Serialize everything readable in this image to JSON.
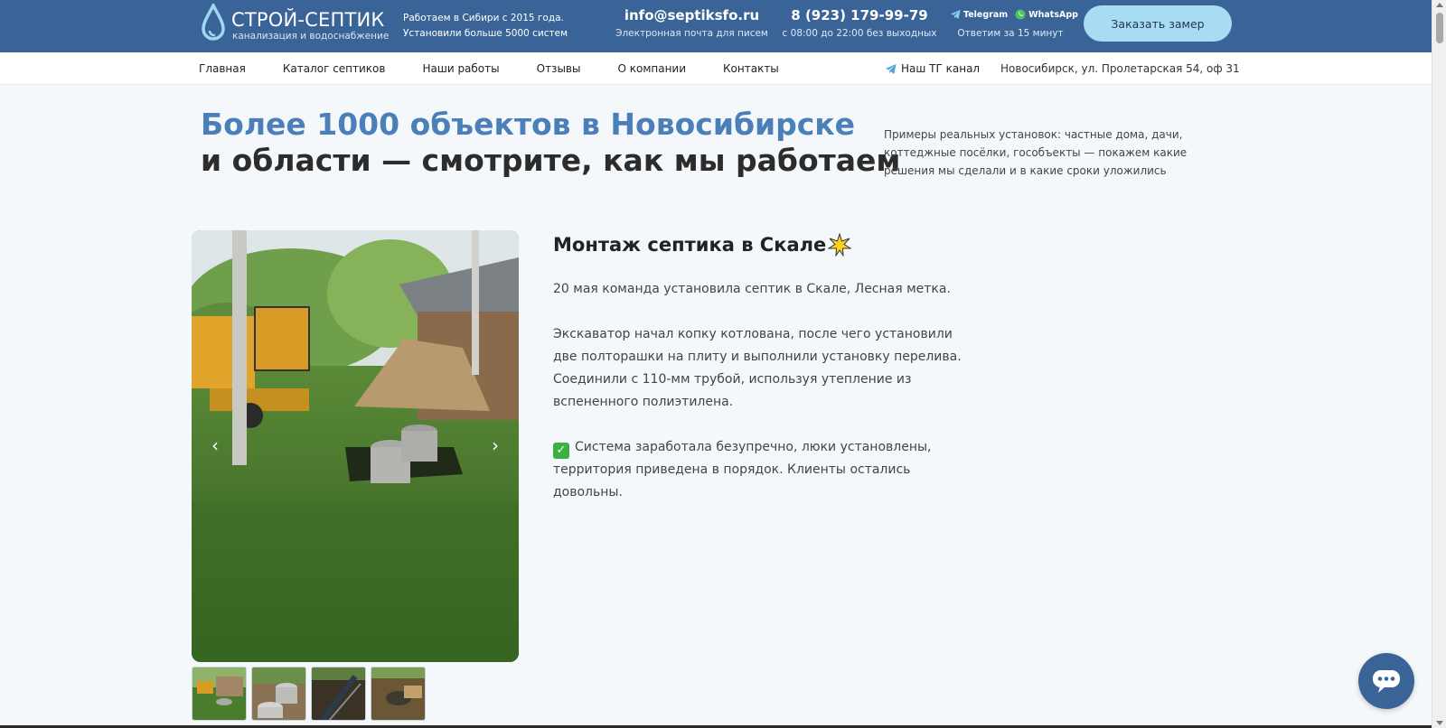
{
  "header": {
    "logo_title": "СТРОЙ-СЕПТИК",
    "logo_subtitle": "канализация и водоснабжение",
    "tagline_1": "Работаем в Сибири с 2015 года.",
    "tagline_2": "Установили больше 5000 систем",
    "email": "info@septiksfo.ru",
    "email_note": "Электронная почта для писем",
    "phone": "8 (923) 179-99-79",
    "phone_note": "с 08:00 до 22:00 без выходных",
    "telegram_label": "Telegram",
    "whatsapp_label": "WhatsApp",
    "messenger_note": "Ответим за 15 минут",
    "order_button": "Заказать замер",
    "colors": {
      "bar": "#3a6497",
      "button": "#a8dcf2"
    }
  },
  "nav": {
    "items": [
      "Главная",
      "Каталог септиков",
      "Наши работы",
      "Отзывы",
      "О компании",
      "Контакты"
    ],
    "tg_channel": "Наш ТГ канал",
    "address": "Новосибирск, ул. Пролетарская 54, оф 31"
  },
  "hero": {
    "title_line_1": "Более 1000 объектов в Новосибирске",
    "title_line_2": "и области — смотрите, как мы работаем",
    "description": "Примеры реальных установок: частные дома, дачи, коттеджные посёлки, гособъекты — покажем какие решения мы сделали и в какие сроки уложились",
    "accent_color": "#4a7fba"
  },
  "gallery": {
    "prev_icon": "chevron-left-icon",
    "next_icon": "chevron-right-icon",
    "thumbnail_count": 4
  },
  "article": {
    "title": "Монтаж септика в Скале",
    "paragraph_1": "20 мая команда установила септик в Скале, Лесная метка.",
    "paragraph_2": "Экскаватор начал копку котлована, после чего установили две полторашки на плиту и выполнили установку перелива. Соединили с 110-мм трубой, используя утепление из вспененного полиэтилена.",
    "paragraph_3": "Система заработала безупречно, люки установлены, территория приведена в порядок. Клиенты остались довольны."
  }
}
